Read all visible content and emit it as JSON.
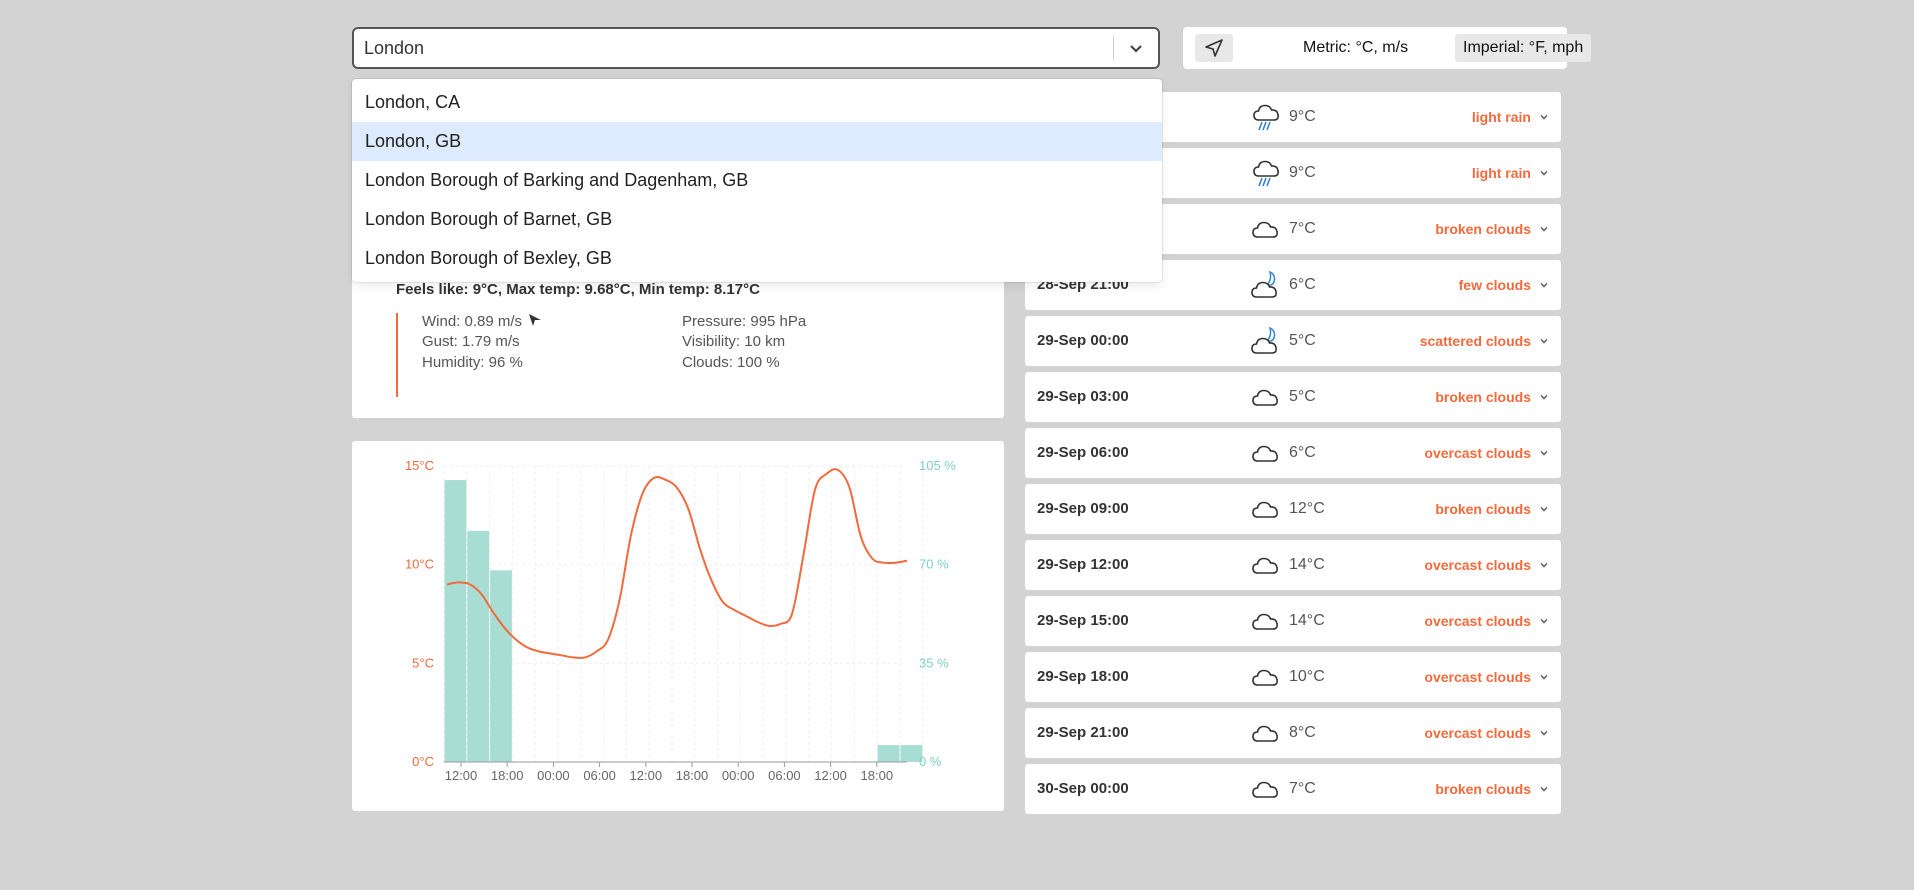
{
  "search": {
    "value": "London"
  },
  "dropdown": {
    "options": [
      {
        "label": "London, CA",
        "selected": false
      },
      {
        "label": "London, GB",
        "selected": true
      },
      {
        "label": "London Borough of Barking and Dagenham, GB",
        "selected": false
      },
      {
        "label": "London Borough of Barnet, GB",
        "selected": false
      },
      {
        "label": "London Borough of Bexley, GB",
        "selected": false
      }
    ]
  },
  "toolbar": {
    "location_icon": "location-arrow-icon",
    "metric_label": "Metric: °C, m/s",
    "imperial_label": "Imperial: °F, mph"
  },
  "current": {
    "feels_line": "Feels like: 9°C, Max temp: 9.68°C, Min temp: 8.17°C",
    "wind": "Wind: 0.89 m/s",
    "gust": "Gust: 1.79 m/s",
    "humidity": "Humidity: 96 %",
    "pressure": "Pressure: 995 hPa",
    "visibility": "Visibility: 10 km",
    "clouds": "Clouds: 100 %",
    "accent_color": "#f06a3c"
  },
  "chart_data": {
    "type": "line+bar",
    "x_tick_labels": [
      "12:00",
      "18:00",
      "00:00",
      "06:00",
      "12:00",
      "18:00",
      "00:00",
      "06:00",
      "12:00",
      "18:00"
    ],
    "y_left_ticks": [
      "0°C",
      "5°C",
      "10°C",
      "15°C"
    ],
    "y_right_ticks": [
      "0 %",
      "35 %",
      "70 %",
      "105 %"
    ],
    "ylim_left": [
      0,
      15
    ],
    "ylim_right": [
      0,
      105
    ],
    "temperature_series": {
      "name": "",
      "color": "#f06a3c",
      "values": [
        9.0,
        9.1,
        9.0,
        8.5,
        7.6,
        6.8,
        6.2,
        5.8,
        5.6,
        5.5,
        5.4,
        5.3,
        5.3,
        5.6,
        6.2,
        8.2,
        11.5,
        13.6,
        14.4,
        14.3,
        13.9,
        12.8,
        10.8,
        9.2,
        8.1,
        7.7,
        7.4,
        7.1,
        6.9,
        7.0,
        7.5,
        10.5,
        13.8,
        14.6,
        14.8,
        13.9,
        11.4,
        10.3,
        10.1,
        10.1,
        10.2
      ]
    },
    "precip_series": {
      "name": "",
      "color": "#a8ddd4",
      "values": [
        100,
        82,
        68,
        0,
        0,
        0,
        0,
        0,
        0,
        0,
        0,
        0,
        0,
        0,
        0,
        0,
        0,
        0,
        0,
        6,
        6
      ]
    },
    "grid": true
  },
  "forecast": [
    {
      "time": "",
      "icon": "rain-cloud-icon",
      "temp": "9°C",
      "desc": "light rain"
    },
    {
      "time": "",
      "icon": "rain-cloud-icon",
      "temp": "9°C",
      "desc": "light rain"
    },
    {
      "time": "",
      "icon": "cloud-icon",
      "temp": "7°C",
      "desc": "broken clouds"
    },
    {
      "time": "28-Sep 21:00",
      "icon": "moon-cloud-icon",
      "temp": "6°C",
      "desc": "few clouds"
    },
    {
      "time": "29-Sep 00:00",
      "icon": "moon-cloud-icon",
      "temp": "5°C",
      "desc": "scattered clouds"
    },
    {
      "time": "29-Sep 03:00",
      "icon": "cloud-icon",
      "temp": "5°C",
      "desc": "broken clouds"
    },
    {
      "time": "29-Sep 06:00",
      "icon": "cloud-icon",
      "temp": "6°C",
      "desc": "overcast clouds"
    },
    {
      "time": "29-Sep 09:00",
      "icon": "cloud-icon",
      "temp": "12°C",
      "desc": "broken clouds"
    },
    {
      "time": "29-Sep 12:00",
      "icon": "cloud-icon",
      "temp": "14°C",
      "desc": "overcast clouds"
    },
    {
      "time": "29-Sep 15:00",
      "icon": "cloud-icon",
      "temp": "14°C",
      "desc": "overcast clouds"
    },
    {
      "time": "29-Sep 18:00",
      "icon": "cloud-icon",
      "temp": "10°C",
      "desc": "overcast clouds"
    },
    {
      "time": "29-Sep 21:00",
      "icon": "cloud-icon",
      "temp": "8°C",
      "desc": "overcast clouds"
    },
    {
      "time": "30-Sep 00:00",
      "icon": "cloud-icon",
      "temp": "7°C",
      "desc": "broken clouds"
    }
  ]
}
